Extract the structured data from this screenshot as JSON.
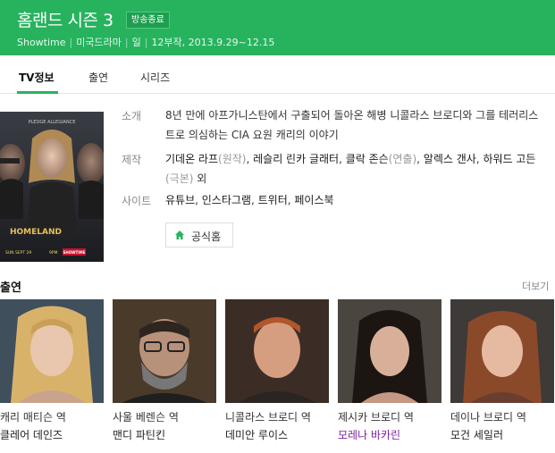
{
  "header": {
    "title": "홈랜드 시즌 3",
    "badge": "방송종료",
    "meta": [
      "Showtime",
      "미국드라마",
      "일",
      "12부작, 2013.9.29~12.15"
    ],
    "bg_color": "#27b35e"
  },
  "tabs": [
    {
      "label": "TV정보",
      "active": true
    },
    {
      "label": "출연",
      "active": false
    },
    {
      "label": "시리즈",
      "active": false
    }
  ],
  "poster": {
    "tagline": "PLEDGE ALLEGIANCE",
    "logo": "HOMELAND",
    "airdate": "SUN SEPT 29",
    "time": "9PM",
    "network": "SHOWTIME"
  },
  "info": {
    "synopsis_label": "소개",
    "synopsis": "8년 만에 아프가니스탄에서 구출되어 돌아온 해병 니콜라스 브로디와 그를 테러리스트로 의심하는 CIA 요원 캐리의 이야기",
    "production_label": "제작",
    "production": [
      {
        "name": "기데온 라프",
        "role": "(원작)"
      },
      {
        "name": "레슬리 린카 글래터",
        "role": ""
      },
      {
        "name": "클락 존슨",
        "role": "(연출)"
      },
      {
        "name": "알렉스 갠사",
        "role": ""
      },
      {
        "name": "하워드 고든",
        "role": "(극본)"
      }
    ],
    "production_suffix": "외",
    "sites_label": "사이트",
    "sites": [
      "유튜브",
      "인스타그램",
      "트위터",
      "페이스북"
    ],
    "homepage_button": "공식홈"
  },
  "cast": {
    "title": "출연",
    "more": "더보기",
    "members": [
      {
        "role": "캐리 매티슨 역",
        "actor": "클레어 데인즈"
      },
      {
        "role": "사울 베렌슨 역",
        "actor": "맨디 파틴킨"
      },
      {
        "role": "니콜라스 브로디 역",
        "actor": "데미안 루이스"
      },
      {
        "role": "제시카 브로디 역",
        "actor": "모레나 바카린"
      },
      {
        "role": "데이나 브로디 역",
        "actor": "모건 세일러"
      }
    ]
  },
  "colors": {
    "accent": "#27b35e",
    "visited_link": "#7b1fa2"
  }
}
